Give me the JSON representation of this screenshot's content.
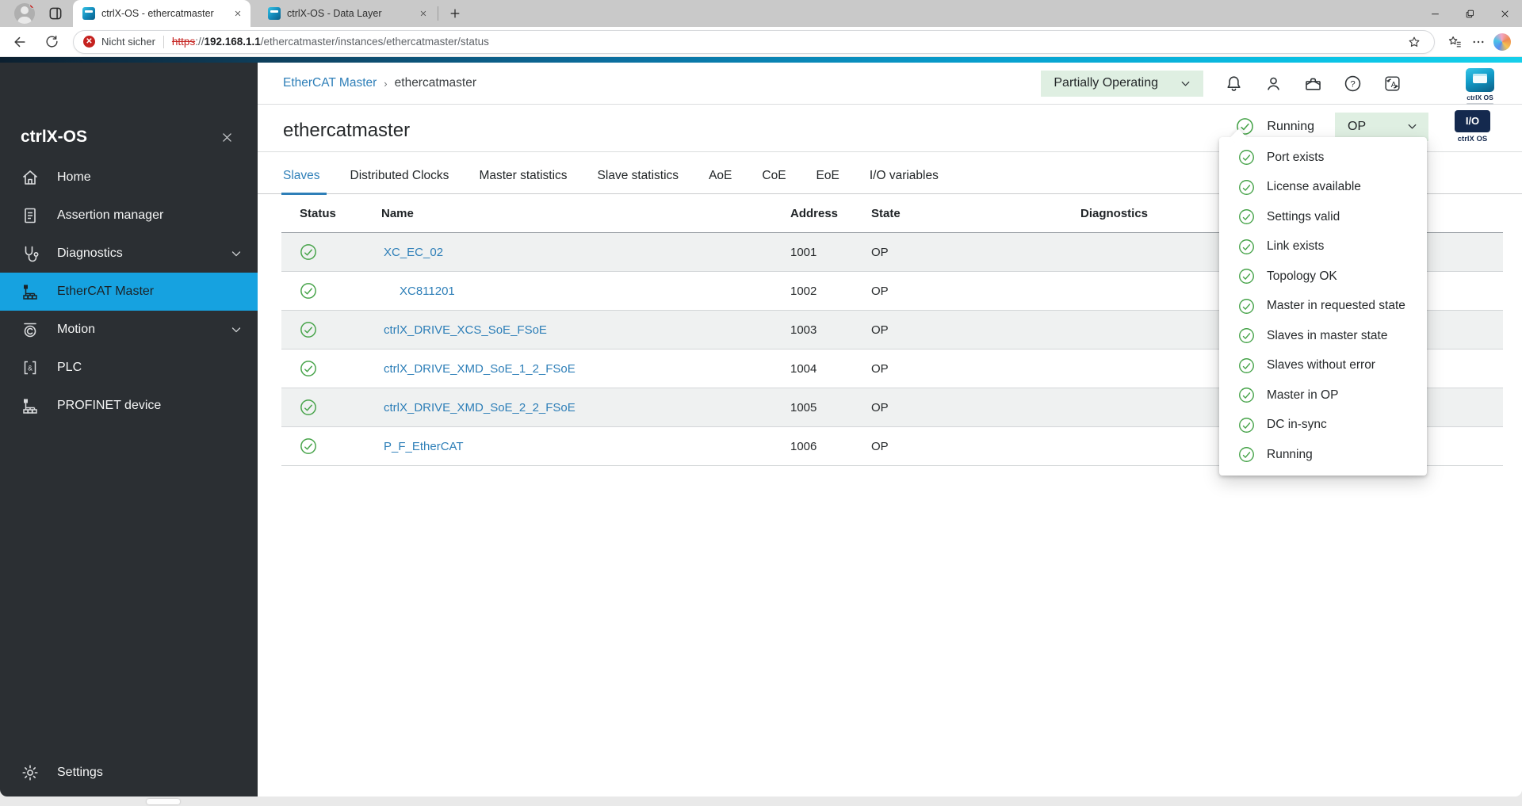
{
  "browser": {
    "tab1": "ctrlX-OS - ethercatmaster",
    "tab2": "ctrlX-OS - Data Layer",
    "security": "Nicht sicher",
    "url_scheme": "https",
    "url_sep": "://",
    "url_host": "192.168.1.1",
    "url_path": "/ethercatmaster/instances/ethercatmaster/status"
  },
  "sidebar": {
    "title": "ctrlX-OS",
    "items": [
      {
        "label": "Home",
        "icon": "home-icon"
      },
      {
        "label": "Assertion manager",
        "icon": "document-icon"
      },
      {
        "label": "Diagnostics",
        "icon": "stethoscope-icon",
        "expandable": true
      },
      {
        "label": "EtherCAT Master",
        "icon": "network-tree-icon",
        "selected": true
      },
      {
        "label": "Motion",
        "icon": "motion-icon",
        "expandable": true
      },
      {
        "label": "PLC",
        "icon": "plc-icon"
      },
      {
        "label": "PROFINET device",
        "icon": "network-tree-icon"
      }
    ],
    "footer": {
      "label": "Settings",
      "icon": "gear-icon"
    }
  },
  "header": {
    "breadcrumb_link": "EtherCAT Master",
    "breadcrumb_current": "ethercatmaster",
    "system_status": "Partially Operating",
    "icons": [
      "bell-icon",
      "user-icon",
      "briefcase-icon",
      "help-icon",
      "language-icon"
    ],
    "logo_label": "ctrlX OS"
  },
  "titlebar": {
    "page_title": "ethercatmaster",
    "master_status": "Running",
    "master_state": "OP",
    "io_badge": "I/O",
    "io_label": "ctrlX OS"
  },
  "tabs": {
    "items": [
      "Slaves",
      "Distributed Clocks",
      "Master statistics",
      "Slave statistics",
      "AoE",
      "CoE",
      "EoE",
      "I/O variables"
    ],
    "active": "Slaves"
  },
  "table": {
    "columns": {
      "status": "Status",
      "name": "Name",
      "address": "Address",
      "state": "State",
      "diagnostics": "Diagnostics"
    },
    "rows": [
      {
        "status_icon": "check-circle-icon",
        "name": "XC_EC_02",
        "address": "1001",
        "state": "OP",
        "child": false
      },
      {
        "status_icon": "check-circle-icon",
        "name": "XC811201",
        "address": "1002",
        "state": "OP",
        "child": true
      },
      {
        "status_icon": "check-circle-icon",
        "name": "ctrlX_DRIVE_XCS_SoE_FSoE",
        "address": "1003",
        "state": "OP",
        "child": false
      },
      {
        "status_icon": "check-circle-icon",
        "name": "ctrlX_DRIVE_XMD_SoE_1_2_FSoE",
        "address": "1004",
        "state": "OP",
        "child": false
      },
      {
        "status_icon": "check-circle-icon",
        "name": "ctrlX_DRIVE_XMD_SoE_2_2_FSoE",
        "address": "1005",
        "state": "OP",
        "child": false
      },
      {
        "status_icon": "check-circle-icon",
        "name": "P_F_EtherCAT",
        "address": "1006",
        "state": "OP",
        "child": false
      }
    ]
  },
  "status_popup": {
    "items": [
      "Port exists",
      "License available",
      "Settings valid",
      "Link exists",
      "Topology OK",
      "Master in requested state",
      "Slaves in master state",
      "Slaves without error",
      "Master in OP",
      "DC in-sync",
      "Running"
    ],
    "item_icon": "check-circle-icon"
  },
  "colors": {
    "accent_blue": "#16A2E0",
    "link_blue": "#2E7FB8",
    "success_green": "#46A349",
    "pill_green_bg": "#DFEFE2",
    "navy": "#14294E",
    "sidebar_bg": "#2B2F33",
    "error_red": "#C5221F"
  }
}
